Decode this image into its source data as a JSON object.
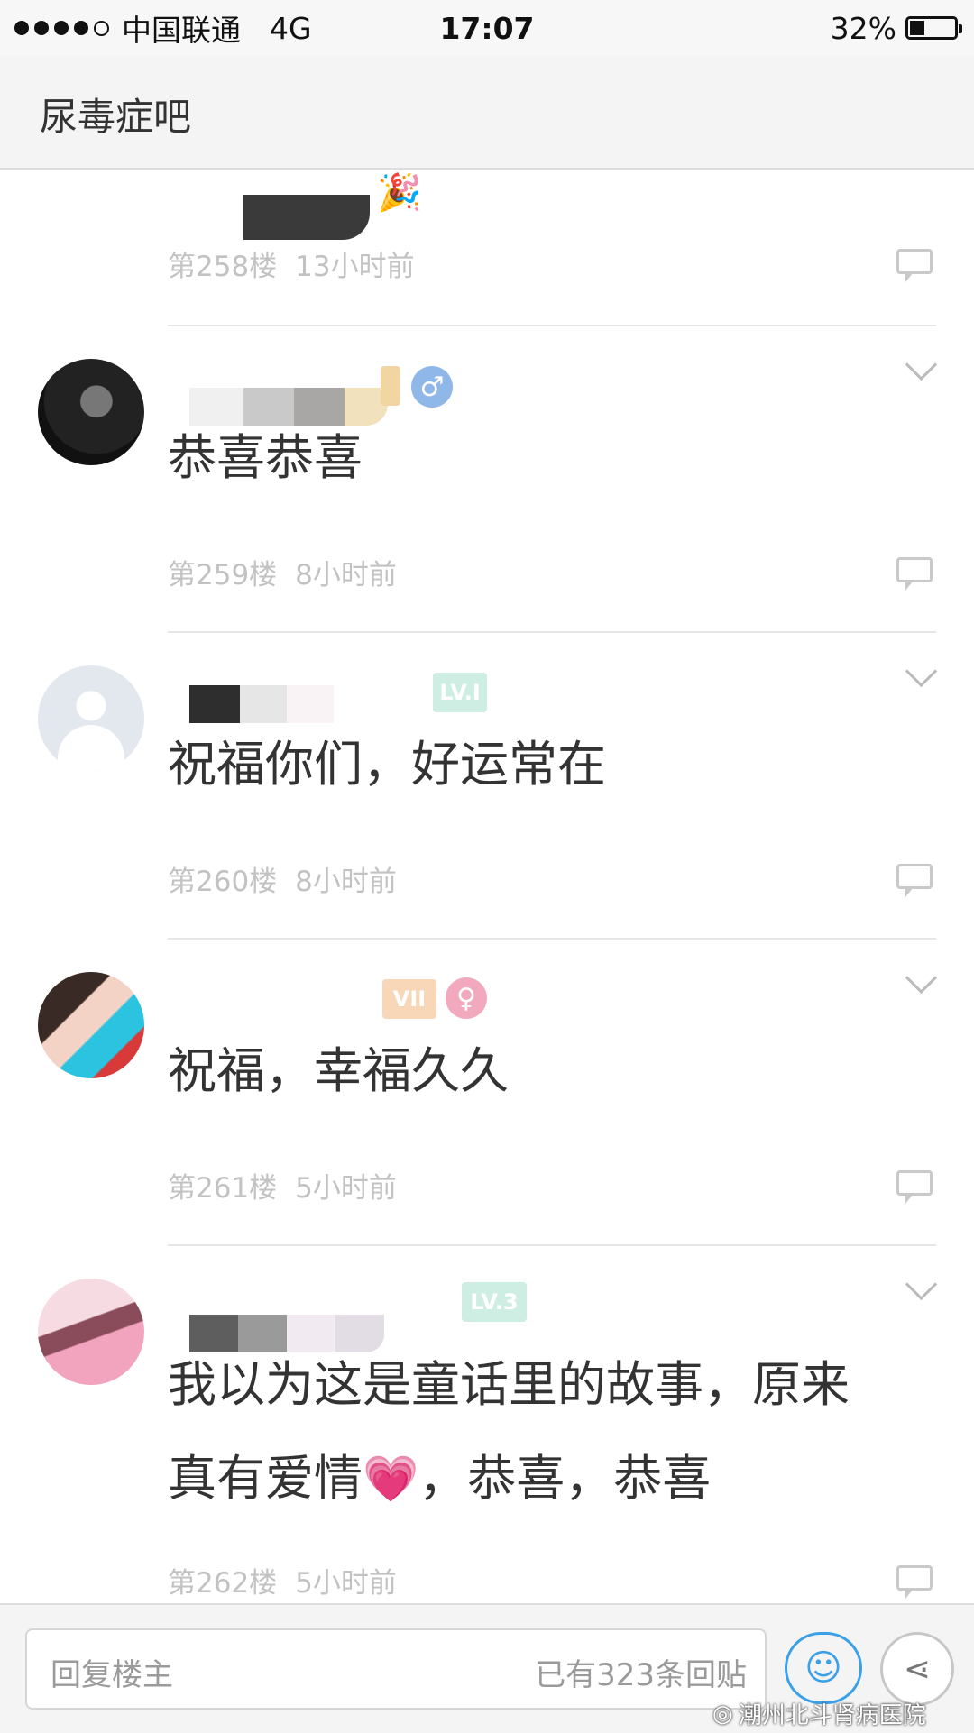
{
  "status_bar": {
    "carrier": "中国联通",
    "network": "4G",
    "time": "17:07",
    "battery": "32%"
  },
  "header": {
    "title": "尿毒症吧"
  },
  "posts": [
    {
      "floor": "第258楼",
      "time": "13小时前"
    },
    {
      "text": "恭喜恭喜",
      "floor": "第259楼",
      "time": "8小时前",
      "gender": "♂"
    },
    {
      "text": "祝福你们，好运常在",
      "floor": "第260楼",
      "time": "8小时前"
    },
    {
      "text": "祝福，幸福久久",
      "floor": "第261楼",
      "time": "5小时前",
      "gender": "♀"
    },
    {
      "text_line1": "我以为这是童话里的故事，原来",
      "text_line2a": "真有爱情",
      "text_line2b": "，恭喜，恭喜",
      "floor": "第262楼",
      "time": "5小时前"
    }
  ],
  "bottom_bar": {
    "reply_placeholder": "回复楼主",
    "reply_count": "已有323条回贴"
  },
  "watermark": "潮州北斗肾病医院",
  "icons": [
    "reply-icon",
    "chevron-down-icon",
    "emoji-icon",
    "share-icon",
    "heart-emoji"
  ]
}
